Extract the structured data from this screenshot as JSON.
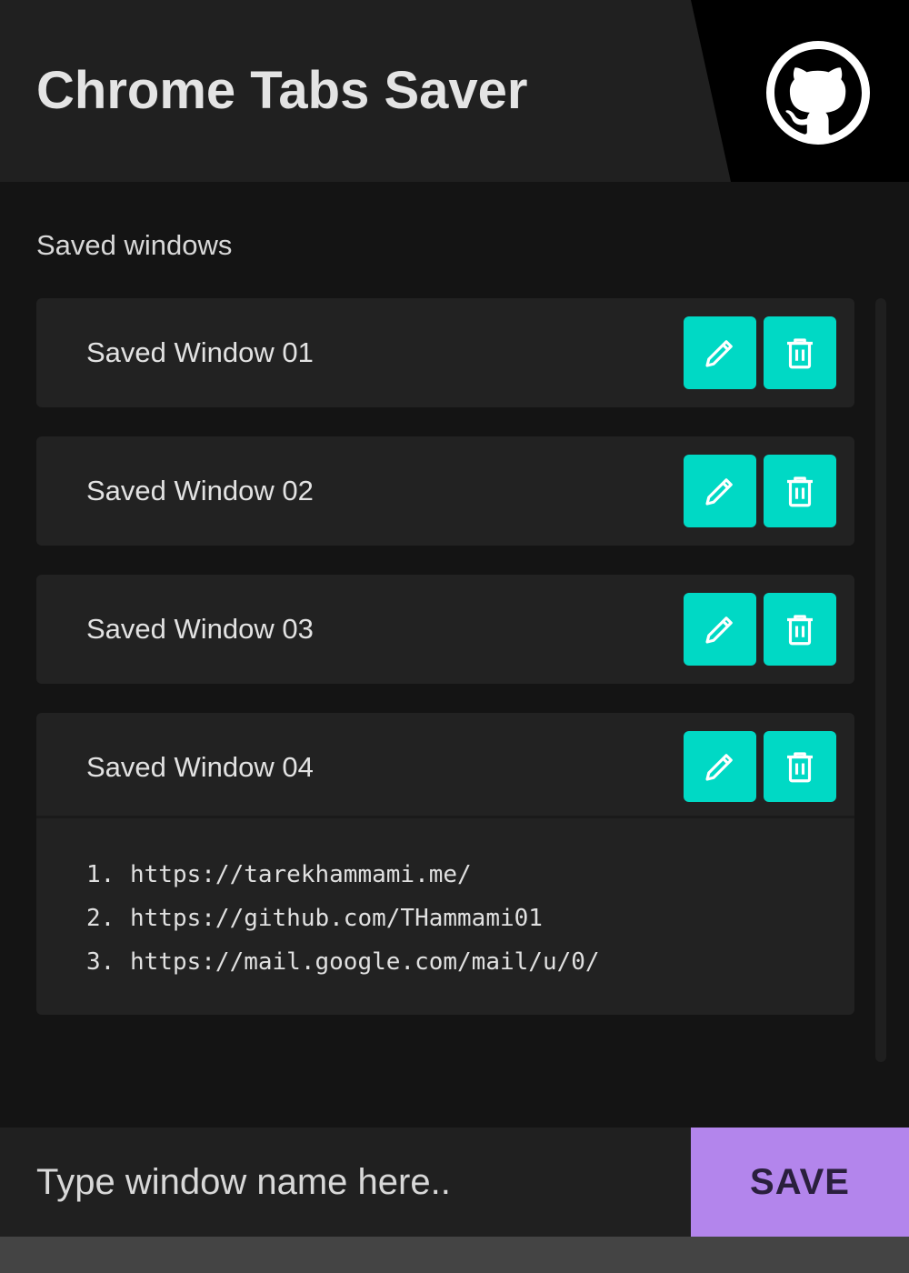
{
  "header": {
    "title": "Chrome Tabs Saver",
    "github_icon": "github-icon"
  },
  "section_label": "Saved windows",
  "windows": [
    {
      "name": "Saved Window 01",
      "expanded": false,
      "tabs": []
    },
    {
      "name": "Saved Window 02",
      "expanded": false,
      "tabs": []
    },
    {
      "name": "Saved Window 03",
      "expanded": false,
      "tabs": []
    },
    {
      "name": "Saved Window 04",
      "expanded": true,
      "tabs": [
        {
          "num": "1.",
          "url": "https://tarekhammami.me/"
        },
        {
          "num": "2.",
          "url": "https://github.com/THammami01"
        },
        {
          "num": "3.",
          "url": "https://mail.google.com/mail/u/0/"
        }
      ]
    }
  ],
  "icons": {
    "edit": "pencil-icon",
    "delete": "trash-icon"
  },
  "footer": {
    "input_placeholder": "Type window name here..",
    "input_value": "",
    "save_label": "SAVE"
  },
  "colors": {
    "accent": "#00d9c5",
    "save_button": "#b385ec",
    "header_bg": "#202020",
    "page_bg": "#141414"
  }
}
